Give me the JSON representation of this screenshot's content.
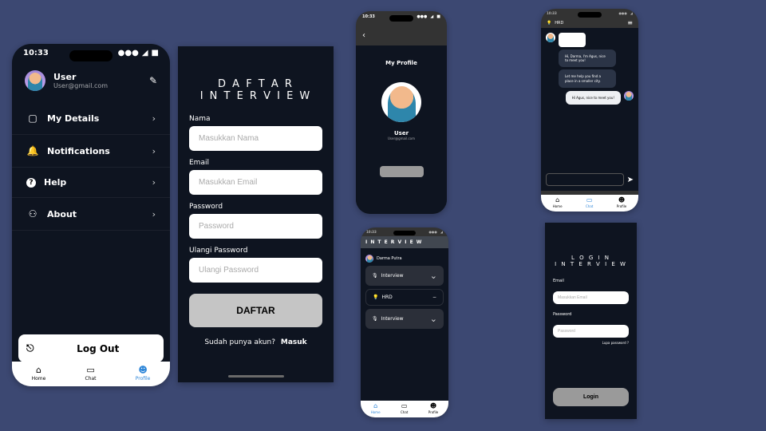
{
  "time": "10:33",
  "signal": "●●●",
  "wifi": "◢",
  "batt": "■",
  "s1": {
    "user_name": "User",
    "user_email": "User@gmail.com",
    "rows": [
      {
        "icon": "▤",
        "label": "My Details"
      },
      {
        "icon": "ὑ4",
        "label": "Notifications"
      },
      {
        "icon": "?",
        "label": "Help"
      },
      {
        "icon": "⚙",
        "label": "About"
      }
    ],
    "logout": "Log Out",
    "tabs": {
      "home": "Home",
      "chat": "Chat",
      "profile": "Profile"
    }
  },
  "s2": {
    "title1": "D A F T A R",
    "title2": "I N T E R V I E W",
    "f_nama_l": "Nama",
    "f_nama_p": "Masukkan Nama",
    "f_email_l": "Email",
    "f_email_p": "Masukkan Email",
    "f_pwd_l": "Password",
    "f_pwd_p": "Password",
    "f_upwd_l": "Ulangi Password",
    "f_upwd_p": "Ulangi Password",
    "btn": "DAFTAR",
    "have": "Sudah punya akun?",
    "masuk": "Masuk"
  },
  "s3": {
    "title": "My Profile",
    "name": "User",
    "email": "User@gmail.com"
  },
  "s4": {
    "title": "I N T E R V I E W",
    "user": "Darma Putra",
    "hrd": "HRD",
    "int": "Interview"
  },
  "s5": {
    "hrd": "HRD",
    "m1": "Hi, Darma, I'm Agus, nice to meet you!",
    "m2": "Let me help you find a place in a smaller city.",
    "m3": "Hi Agus, nice to meet you!",
    "tabs": {
      "home": "Home",
      "chat": "Chat",
      "profile": "Profile"
    }
  },
  "s6": {
    "title1": "L O G I N",
    "title2": "I N T E R V I E W",
    "f_email_l": "Email",
    "f_email_p": "Masukkan Email",
    "f_pwd_l": "Password",
    "f_pwd_p": "Password",
    "forgot": "Lupa password ?",
    "btn": "Login"
  }
}
